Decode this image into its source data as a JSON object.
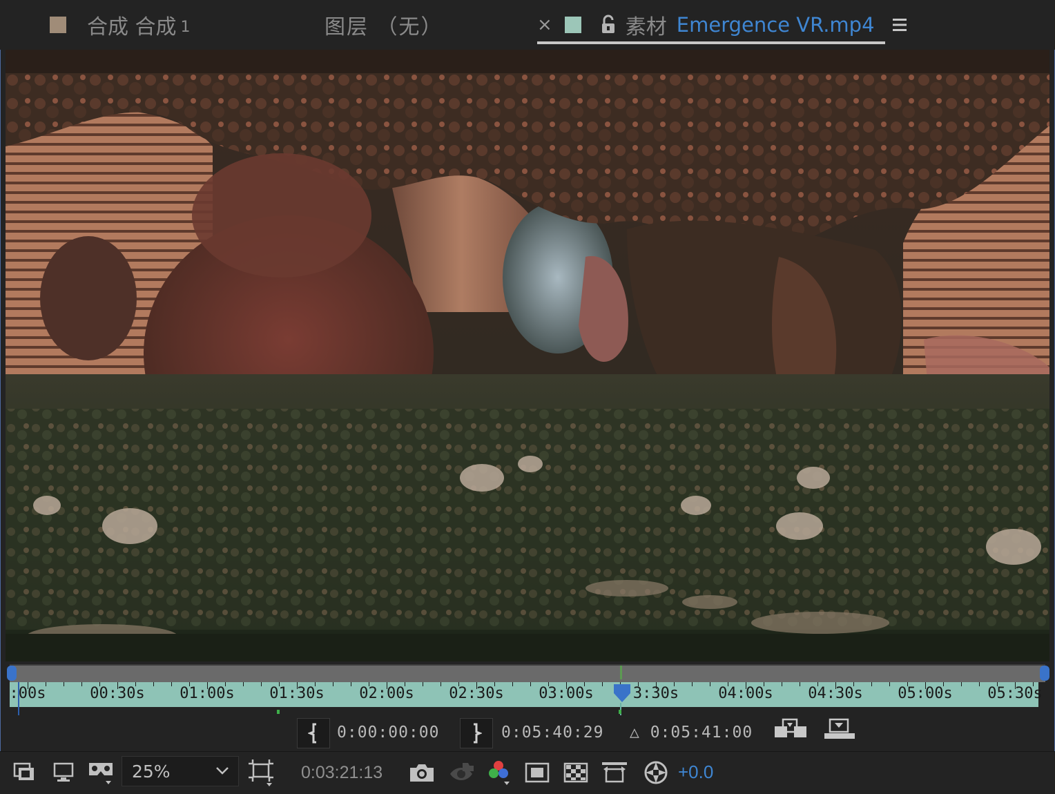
{
  "tabs": {
    "composition": {
      "label": "合成 合成",
      "number": "1"
    },
    "layer": {
      "label": "图层 （无）"
    },
    "footage": {
      "close": "×",
      "kind": "素材",
      "filename": "Emergence VR.mp4"
    }
  },
  "timeline": {
    "ticks": [
      ":00s",
      "00:30s",
      "01:00s",
      "01:30s",
      "02:00s",
      "02:30s",
      "03:00s",
      "3:30s",
      "04:00s",
      "04:30s",
      "05:00s",
      "05:30s"
    ],
    "in_point": "0:00:00:00",
    "out_point": "0:05:40:29",
    "duration": "△ 0:05:41:00"
  },
  "toolbar": {
    "zoom": "25%",
    "current_time": "0:03:21:13",
    "exposure": "+0.0"
  },
  "colors": {
    "accent": "#3f86d2",
    "ruler": "#8ec3b6",
    "composition_swatch": "#a08c78",
    "footage_swatch": "#9cc6b8",
    "playhead": "#3a73c9"
  },
  "icons": [
    "lock-icon",
    "panel-menu-icon",
    "in-bracket-icon",
    "out-bracket-icon",
    "ripple-insert-icon",
    "overlay-edit-icon",
    "always-preview-icon",
    "monitor-icon",
    "vr-headset-icon",
    "region-of-interest-icon",
    "camera-icon",
    "show-snapshot-icon",
    "rgb-channels-icon",
    "toggle-mask-icon",
    "transparency-grid-icon",
    "fit-view-icon",
    "exposure-reset-icon"
  ]
}
